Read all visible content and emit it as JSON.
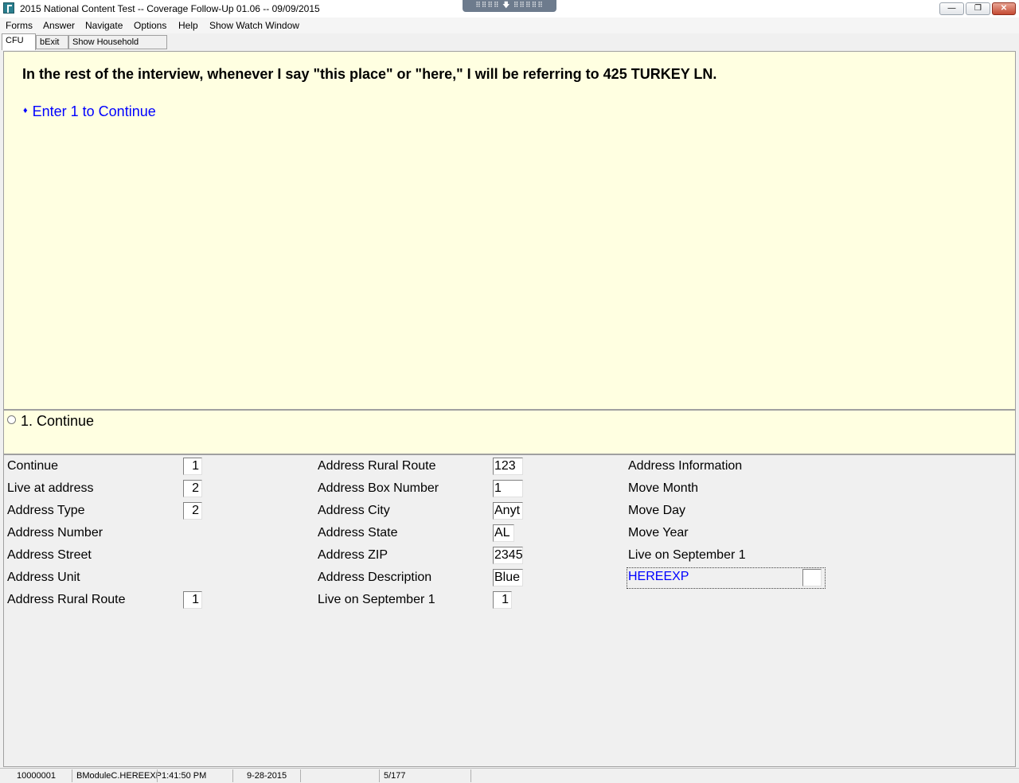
{
  "window": {
    "title": "2015 National Content Test -- Coverage Follow-Up 01.06 -- 09/09/2015",
    "drag_handle": "⠿⠿⠿⠿ 🡇 ⠿⠿⠿⠿⠿",
    "minimize": "—",
    "restore": "❐",
    "close": "✕"
  },
  "menu": {
    "forms": "Forms",
    "answer": "Answer",
    "navigate": "Navigate",
    "options": "Options",
    "help": "Help",
    "watch": "Show Watch Window"
  },
  "tabs": {
    "cfu": "CFU",
    "bexit": "bExit",
    "roster": "Show Household Roster"
  },
  "question": {
    "text": "In the rest of the interview, whenever I say \"this place\" or \"here,\" I will be referring to 425 TURKEY LN.",
    "instruction_bullet": "♦",
    "instruction": "Enter 1 to Continue"
  },
  "answers": {
    "option1": "1. Continue"
  },
  "fields": {
    "col1": [
      {
        "label": "Continue",
        "value": "1"
      },
      {
        "label": "Live at address",
        "value": "2"
      },
      {
        "label": "Address Type",
        "value": "2"
      },
      {
        "label": "Address Number",
        "value": ""
      },
      {
        "label": "Address Street",
        "value": ""
      },
      {
        "label": "Address Unit",
        "value": ""
      },
      {
        "label": "Address Rural Route",
        "value": "1"
      }
    ],
    "col2": [
      {
        "label": "Address Rural Route",
        "value": "123"
      },
      {
        "label": "Address Box Number",
        "value": "1"
      },
      {
        "label": "Address City",
        "value": "Anyt"
      },
      {
        "label": "Address State",
        "value": "AL"
      },
      {
        "label": "Address ZIP",
        "value": "2345"
      },
      {
        "label": "Address Description",
        "value": "Blue"
      },
      {
        "label": "Live on September 1",
        "value": "1"
      }
    ],
    "col3": [
      {
        "label": "Address Information"
      },
      {
        "label": "Move Month"
      },
      {
        "label": "Move Day"
      },
      {
        "label": "Move Year"
      },
      {
        "label": "Live on September 1"
      }
    ],
    "current": {
      "label": "HEREEXP",
      "value": ""
    }
  },
  "status": {
    "case_id": "10000001",
    "field_name": "BModuleC.HEREEXP",
    "time": "1:41:50 PM",
    "date": "9-28-2015",
    "page": "5/177"
  }
}
